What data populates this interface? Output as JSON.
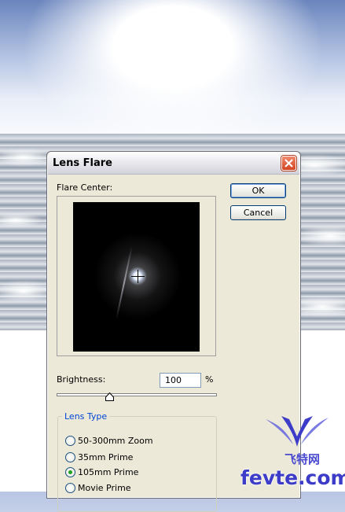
{
  "dialog": {
    "title": "Lens Flare",
    "flare_center_label": "Flare Center:",
    "ok_label": "OK",
    "cancel_label": "Cancel",
    "brightness_label": "Brightness:",
    "brightness_value": "100",
    "brightness_unit": "%",
    "brightness_slider_fraction": 0.33,
    "lens_type_label": "Lens Type",
    "lens_types": [
      {
        "label": "50-300mm Zoom",
        "checked": false
      },
      {
        "label": "35mm Prime",
        "checked": false
      },
      {
        "label": "105mm Prime",
        "checked": true
      },
      {
        "label": "Movie Prime",
        "checked": false
      }
    ]
  },
  "watermark": {
    "chinese_text": "飞特网",
    "site_text": "fevte.com"
  },
  "icons": [
    "close-icon",
    "crosshair-icon",
    "slider-thumb-icon",
    "watermark-logo-icon"
  ],
  "colors": {
    "dialog_bg": "#ece9d8",
    "group_label": "#0046d5",
    "close_button": "#d2431f",
    "watermark": "#3c3cc8",
    "radio_checked": "#21a121"
  }
}
